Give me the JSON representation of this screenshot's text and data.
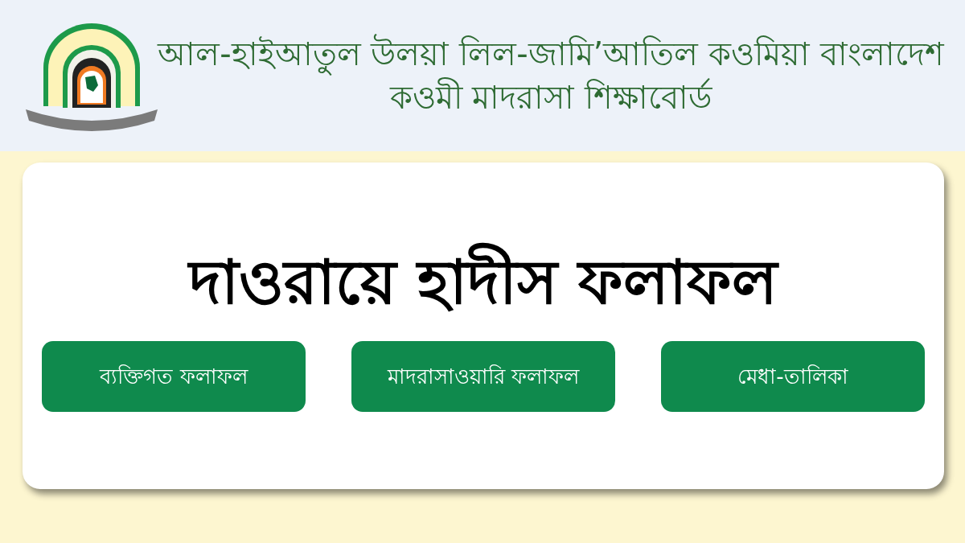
{
  "header": {
    "title_lines": [
      "আল-হাইআতুল উলয়া লিল-জামি’আতিল কওমিয়া বাংলাদেশ",
      "কওমী মাদরাসা শিক্ষাবোর্ড"
    ]
  },
  "card": {
    "heading": "দাওরায়ে হাদীস ফলাফল",
    "buttons": [
      {
        "label": "ব্যক্তিগত ফলাফল"
      },
      {
        "label": "মাদরাসাওয়ারি ফলাফল"
      },
      {
        "label": "মেধা-তালিকা"
      }
    ]
  }
}
